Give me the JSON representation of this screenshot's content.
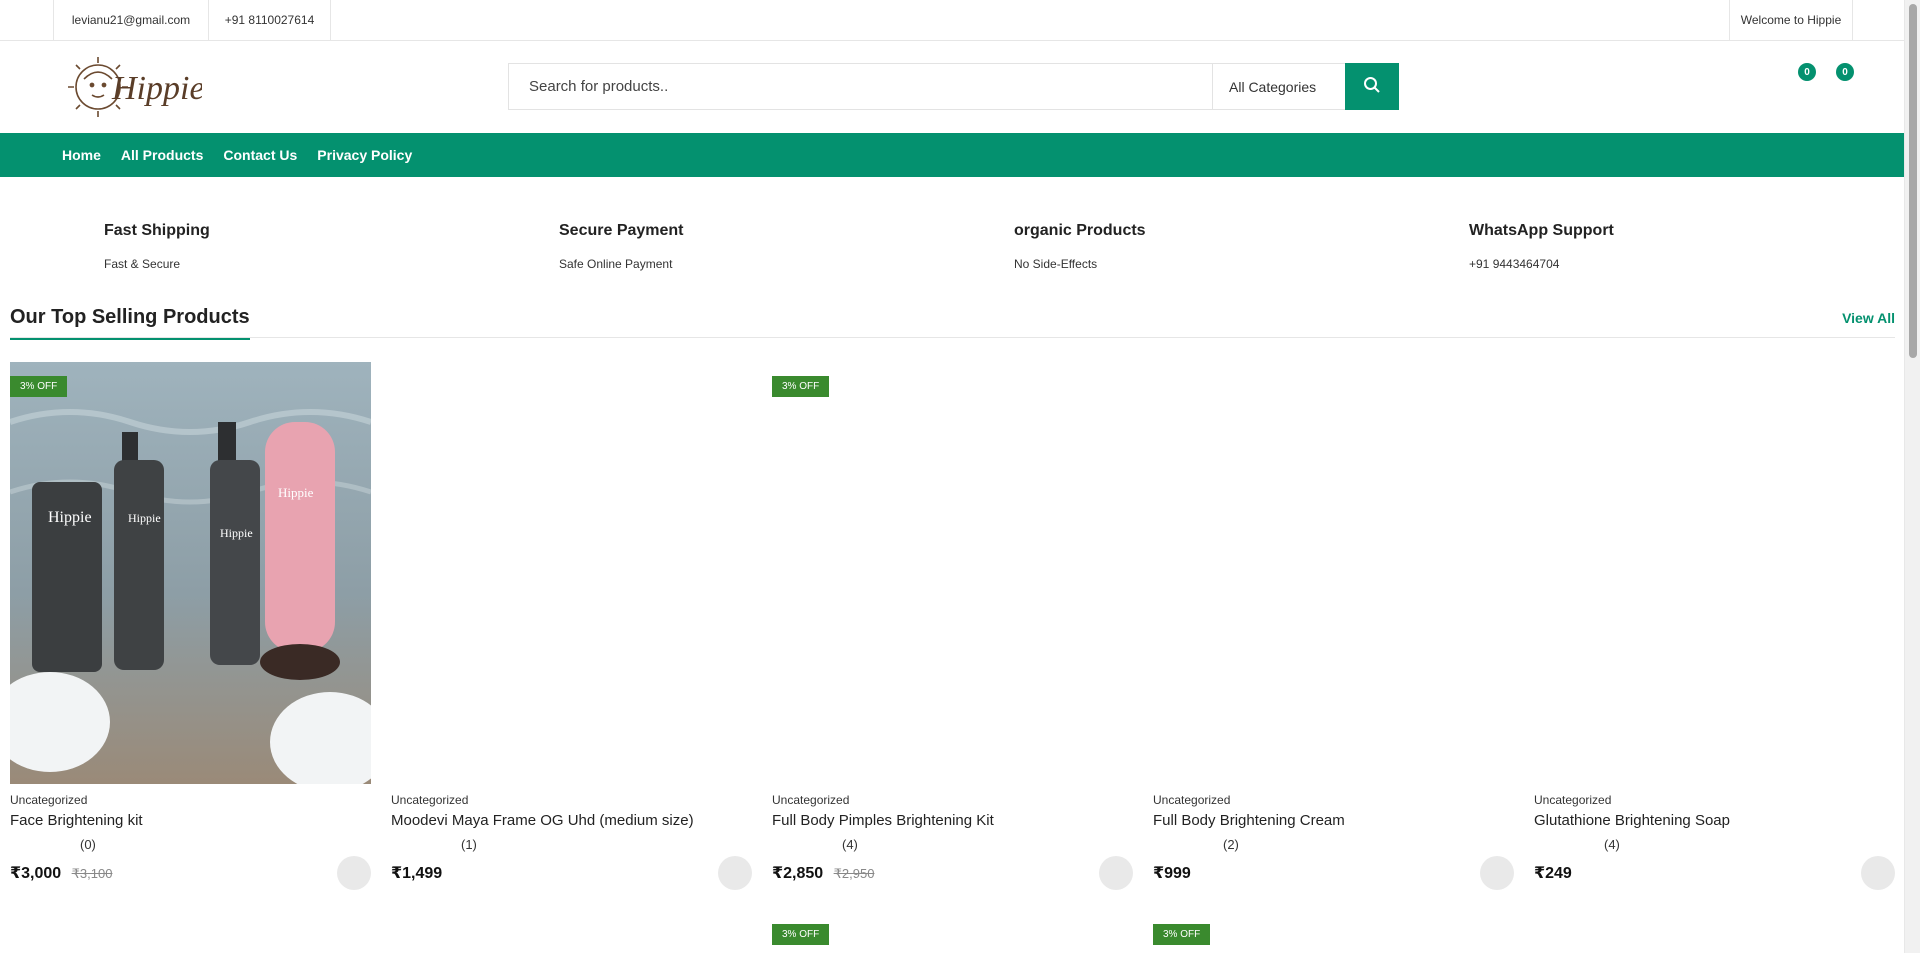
{
  "topbar": {
    "email": "levianu21@gmail.com",
    "phone": "+91 8110027614",
    "welcome": "Welcome to Hippie"
  },
  "header": {
    "logo_text": "Hippie",
    "search_placeholder": "Search for products..",
    "category": "All Categories",
    "wishlist_count": "0",
    "cart_count": "0",
    "accent": "#04916f"
  },
  "nav": {
    "items": [
      "Home",
      "All Products",
      "Contact Us",
      "Privacy Policy"
    ]
  },
  "features": [
    {
      "title": "Fast Shipping",
      "desc": "Fast & Secure"
    },
    {
      "title": "Secure Payment",
      "desc": "Safe Online Payment"
    },
    {
      "title": "organic Products",
      "desc": "No Side-Effects"
    },
    {
      "title": "WhatsApp Support",
      "desc": "+91 9443464704"
    }
  ],
  "section": {
    "title": "Our Top Selling Products",
    "view_all": "View All"
  },
  "products": [
    {
      "badge": "3% OFF",
      "category": "Uncategorized",
      "name": "Face Brightening kit",
      "reviews": "(0)",
      "price": "₹3,000",
      "old_price": "₹3,100"
    },
    {
      "badge": "",
      "category": "Uncategorized",
      "name": "Moodevi Maya Frame OG Uhd (medium size)",
      "reviews": "(1)",
      "price": "₹1,499",
      "old_price": ""
    },
    {
      "badge": "3% OFF",
      "category": "Uncategorized",
      "name": "Full Body Pimples Brightening Kit",
      "reviews": "(4)",
      "price": "₹2,850",
      "old_price": "₹2,950"
    },
    {
      "badge": "",
      "category": "Uncategorized",
      "name": "Full Body Brightening Cream",
      "reviews": "(2)",
      "price": "₹999",
      "old_price": ""
    },
    {
      "badge": "",
      "category": "Uncategorized",
      "name": "Glutathione Brightening Soap",
      "reviews": "(4)",
      "price": "₹249",
      "old_price": ""
    }
  ],
  "next_row_badges": [
    "3% OFF",
    "3% OFF"
  ]
}
